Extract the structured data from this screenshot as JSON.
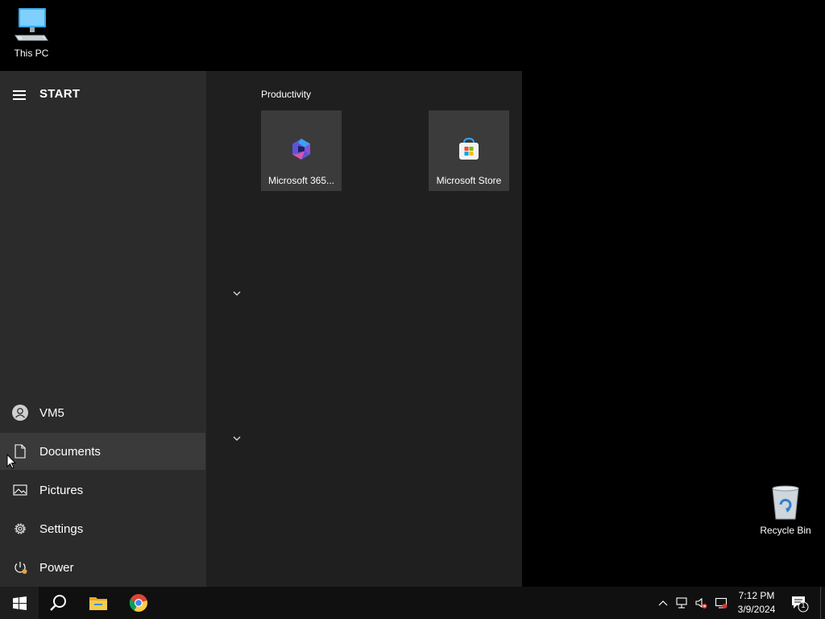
{
  "desktop": {
    "icons": [
      {
        "label": "This PC"
      },
      {
        "label": "Recycle Bin"
      }
    ]
  },
  "start_menu": {
    "title": "START",
    "user": {
      "label": "VM5"
    },
    "items": [
      {
        "label": "Documents",
        "icon": "document-icon"
      },
      {
        "label": "Pictures",
        "icon": "pictures-icon"
      },
      {
        "label": "Settings",
        "icon": "gear-icon"
      },
      {
        "label": "Power",
        "icon": "power-icon"
      }
    ],
    "group": {
      "label": "Productivity",
      "tiles": [
        {
          "label": "Microsoft 365...",
          "icon": "microsoft-365-icon"
        },
        {
          "label": "Microsoft Store",
          "icon": "microsoft-store-icon"
        }
      ]
    }
  },
  "taskbar": {
    "pinned": [
      "start-icon",
      "search-icon",
      "file-explorer-icon",
      "chrome-icon"
    ],
    "tray": [
      "chevron-up-icon",
      "network-icon",
      "volume-muted-icon",
      "display-icon"
    ],
    "clock": {
      "time": "7:12 PM",
      "date": "3/9/2024"
    },
    "notification_count": "1"
  },
  "colors": {
    "start_left_bg": "#2b2b2b",
    "start_right_bg": "#1f1f1f",
    "tile_bg": "#3b3b3b",
    "taskbar_bg": "#101010"
  }
}
